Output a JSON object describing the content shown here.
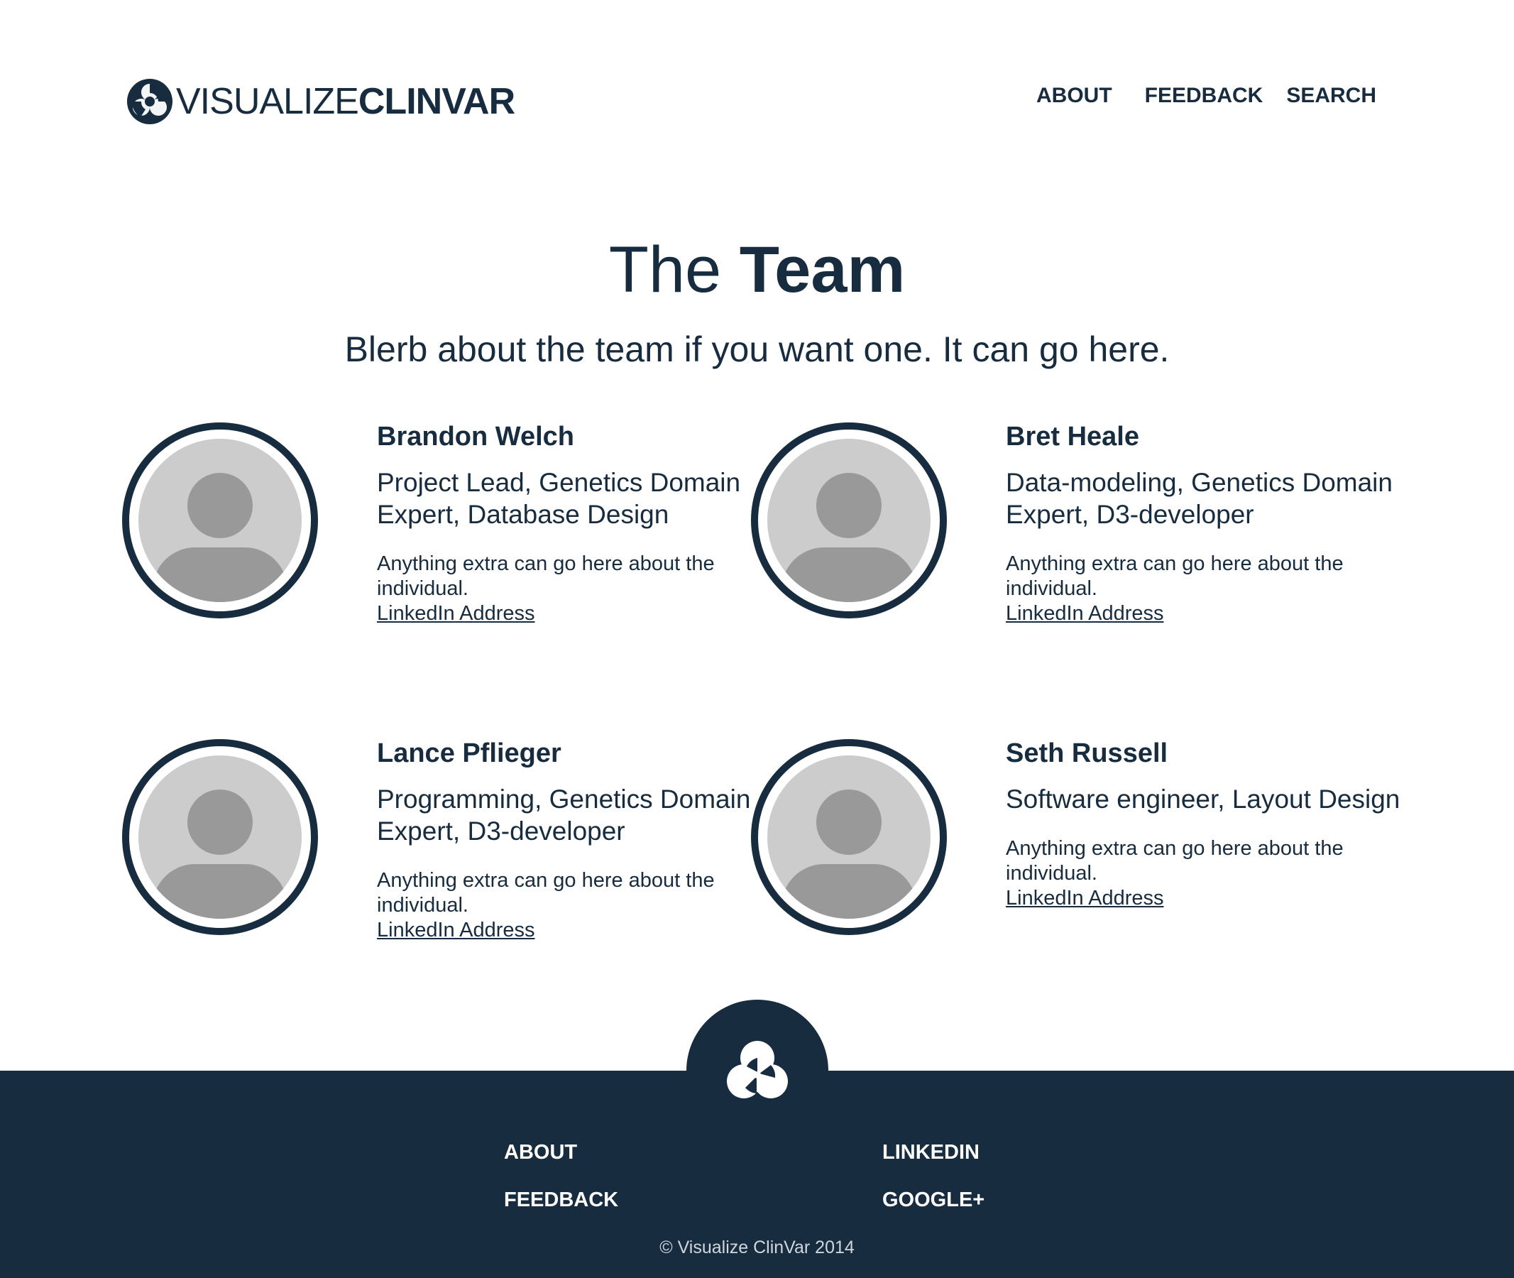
{
  "header": {
    "logo": {
      "text_light": "VISUALIZE",
      "text_bold": "CLINVAR",
      "icon": "clinvar-logo-icon"
    },
    "nav": {
      "about": "ABOUT",
      "feedback": "FEEDBACK",
      "search": "SEARCH"
    }
  },
  "hero": {
    "title_light": "The ",
    "title_bold": "Team",
    "intro": "Blerb about the team if you want one. It can go here."
  },
  "team": [
    {
      "name": "Brandon Welch",
      "role": "Project Lead, Genetics Domain Expert, Database Design",
      "note": "Anything extra can go here about the individual.",
      "link": "LinkedIn Address",
      "avatar_icon": "user-placeholder-icon"
    },
    {
      "name": "Bret Heale",
      "role": "Data-modeling, Genetics Domain Expert, D3-developer",
      "note": "Anything extra can go here about the individual.",
      "link": "LinkedIn Address",
      "avatar_icon": "user-placeholder-icon"
    },
    {
      "name": "Lance Pflieger",
      "role": "Programming, Genetics Domain Expert, D3-developer",
      "note": "Anything extra can go here about the individual.",
      "link": "LinkedIn Address",
      "avatar_icon": "user-placeholder-icon"
    },
    {
      "name": "Seth Russell",
      "role": "Software engineer, Layout Design",
      "note": "Anything extra can go here about the individual.",
      "link": "LinkedIn Address",
      "avatar_icon": "user-placeholder-icon"
    }
  ],
  "footer": {
    "links": {
      "about": "ABOUT",
      "feedback": "FEEDBACK",
      "linkedin": "LINKEDIN",
      "googleplus": "GOOGLE+"
    },
    "copyright": "© Visualize ClinVar 2014",
    "logo_icon": "clinvar-logo-icon"
  },
  "colors": {
    "brand_navy": "#172c3f",
    "avatar_light": "#cccccc",
    "avatar_dark": "#999999",
    "footer_text": "#ffffff"
  }
}
